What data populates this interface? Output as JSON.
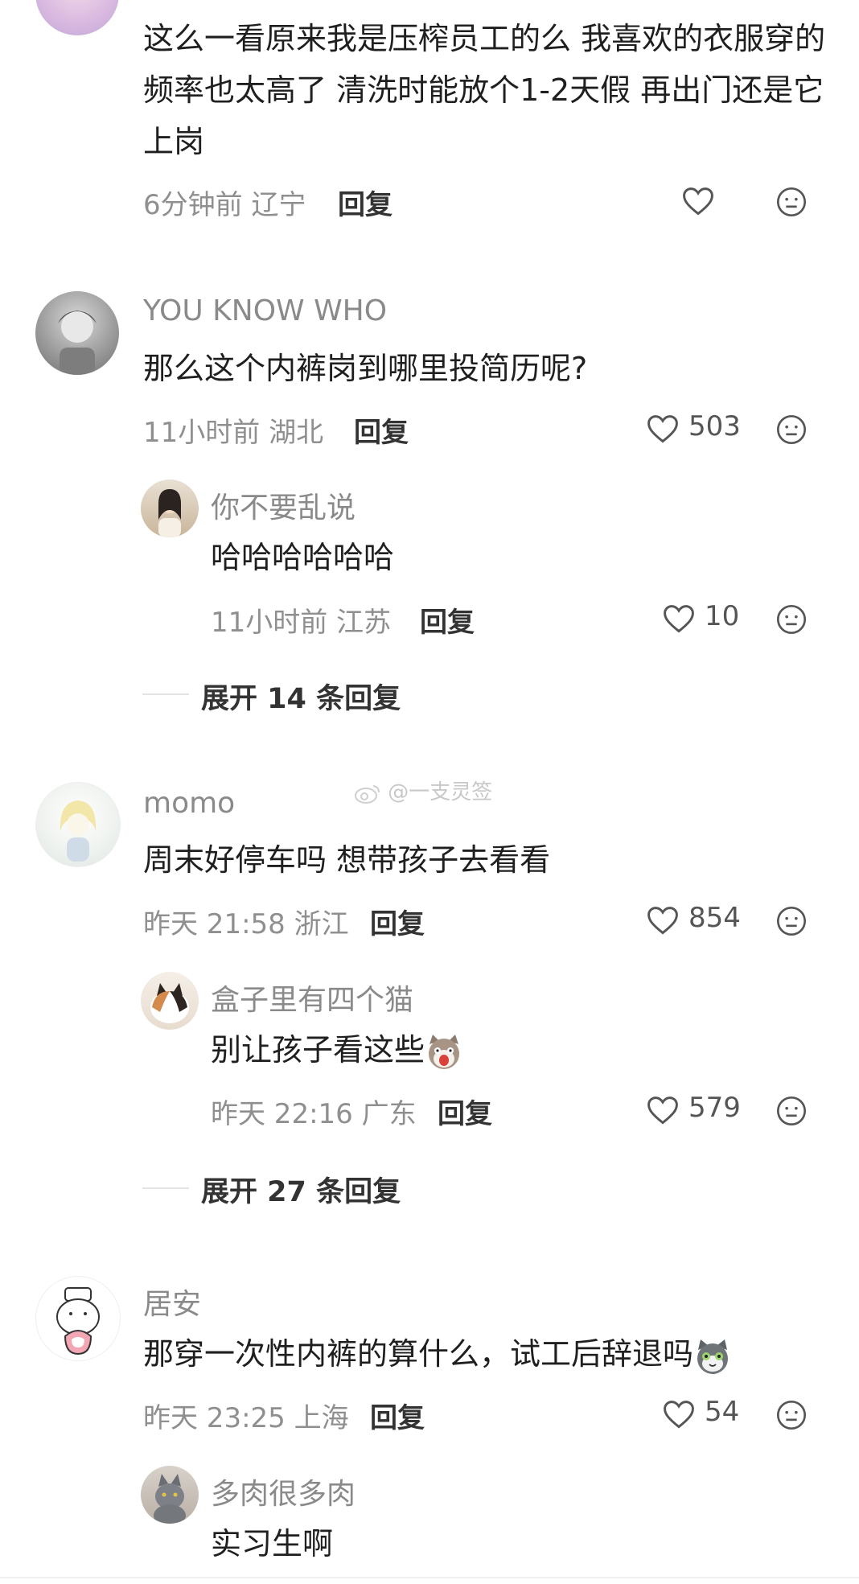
{
  "watermark": "@一支灵签",
  "comments": [
    {
      "text": "这么一看原来我是压榨员工的么 我喜欢的衣服穿的频率也太高了 清洗时能放个1-2天假 再出门还是它上岗",
      "time_location": "6分钟前 辽宁",
      "reply_label": "回复",
      "likes": ""
    },
    {
      "username": "YOU KNOW WHO",
      "text": "那么这个内裤岗到哪里投简历呢?",
      "time_location": "11小时前 湖北",
      "reply_label": "回复",
      "likes": "503",
      "sub_reply": {
        "username": "你不要乱说",
        "text": "哈哈哈哈哈哈",
        "time_location": "11小时前 江苏",
        "reply_label": "回复",
        "likes": "10"
      },
      "expand_label": "展开 14 条回复"
    },
    {
      "username": "momo",
      "text": "周末好停车吗 想带孩子去看看",
      "time_location": "昨天 21:58 浙江",
      "reply_label": "回复",
      "likes": "854",
      "sub_reply": {
        "username": "盒子里有四个猫",
        "text": "别让孩子看这些",
        "emoji": "shocked-cat-emoji",
        "time_location": "昨天 22:16 广东",
        "reply_label": "回复",
        "likes": "579"
      },
      "expand_label": "展开 27 条回复"
    },
    {
      "username": "居安",
      "text": "那穿一次性内裤的算什么，试工后辞退吗",
      "emoji": "cat-emoji",
      "time_location": "昨天 23:25 上海",
      "reply_label": "回复",
      "likes": "54",
      "sub_reply": {
        "username": "多肉很多肉",
        "text": "实习生啊"
      }
    }
  ],
  "icons": {
    "like": "heart-outline-icon",
    "dislike": "neutral-face-icon"
  },
  "colors": {
    "text": "#1f1f1f",
    "meta": "#8f8f8f",
    "icon": "#555555"
  }
}
